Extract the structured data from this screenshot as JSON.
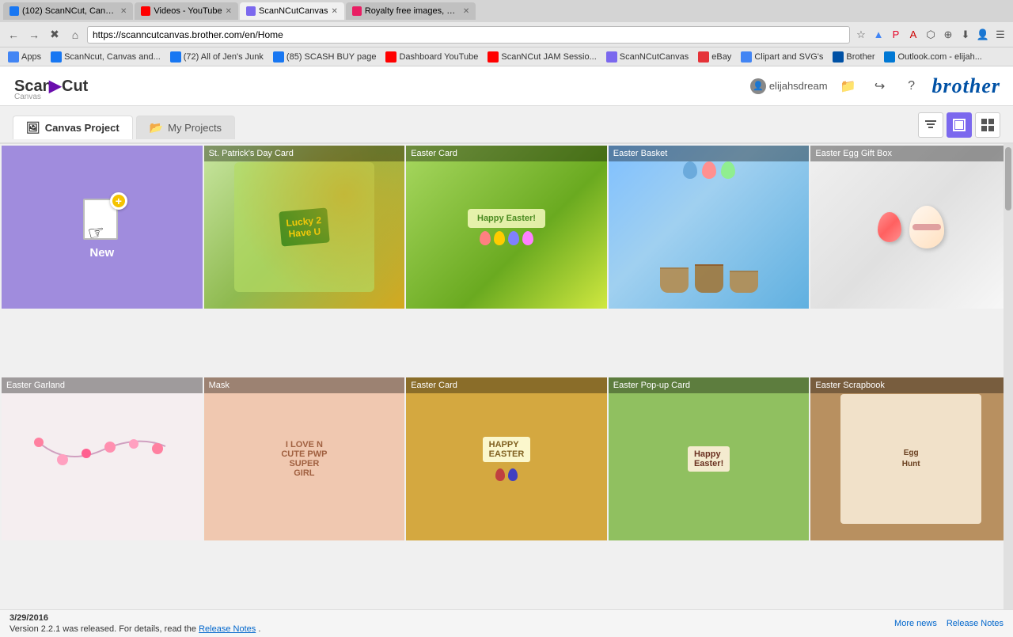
{
  "browser": {
    "tabs": [
      {
        "id": "tab1",
        "label": "(102) ScanNCut, Canvas...",
        "favicon_color": "#1877f2",
        "active": false
      },
      {
        "id": "tab2",
        "label": "Videos - YouTube",
        "favicon_color": "#ff0000",
        "active": false
      },
      {
        "id": "tab3",
        "label": "ScanNCutCanvas",
        "favicon_color": "#7b68ee",
        "active": true
      },
      {
        "id": "tab4",
        "label": "Royalty free images, pho...",
        "favicon_color": "#e91e63",
        "active": false
      }
    ],
    "address": "https://scanncutcanvas.brother.com/en/Home",
    "bookmarks": [
      {
        "label": "Apps",
        "favicon_color": "#4285f4"
      },
      {
        "label": "ScanNcut, Canvas and...",
        "favicon_color": "#1877f2"
      },
      {
        "label": "(72) All of Jen's Junk",
        "favicon_color": "#1877f2"
      },
      {
        "label": "(85) SCASH BUY page",
        "favicon_color": "#1877f2"
      },
      {
        "label": "Dashboard YouTube",
        "favicon_color": "#ff0000"
      },
      {
        "label": "ScanNCut JAM Sessio...",
        "favicon_color": "#ff0000"
      },
      {
        "label": "ScanNCutCanvas",
        "favicon_color": "#7b68ee"
      },
      {
        "label": "eBay",
        "favicon_color": "#e53238"
      },
      {
        "label": "Clipart and SVG's",
        "favicon_color": "#4285f4"
      },
      {
        "label": "Brother",
        "favicon_color": "#0051a5"
      },
      {
        "label": "Outlook.com - elijah...",
        "favicon_color": "#0078d4"
      }
    ]
  },
  "app": {
    "logo_scan": "Scan",
    "logo_ncut": "NCut",
    "logo_canvas": "Canvas",
    "username": "elijahsdream",
    "brother_label": "brother"
  },
  "tabs": {
    "canvas_project_label": "Canvas Project",
    "my_projects_label": "My Projects"
  },
  "view_buttons": {
    "filter_icon": "⊟",
    "single_icon": "▣",
    "grid_icon": "⊞"
  },
  "projects": {
    "new_label": "New",
    "items": [
      {
        "id": "stpatrick",
        "title": "St. Patrick's Day Card",
        "style": "card-stpatrick"
      },
      {
        "id": "easter-card-1",
        "title": "Easter Card",
        "style": "card-easter1"
      },
      {
        "id": "basket",
        "title": "Easter Basket",
        "style": "card-basket"
      },
      {
        "id": "egg-box",
        "title": "Easter Egg Gift Box",
        "style": "card-egg"
      },
      {
        "id": "garland",
        "title": "Easter Garland",
        "style": "card-garland"
      },
      {
        "id": "mask",
        "title": "Mask",
        "style": "card-mask"
      },
      {
        "id": "easter-card-2",
        "title": "Easter Card",
        "style": "card-easter2"
      },
      {
        "id": "popup",
        "title": "Easter Pop-up Card",
        "style": "card-popup"
      },
      {
        "id": "scrapbook",
        "title": "Easter Scrapbook",
        "style": "card-scrapbook"
      }
    ]
  },
  "footer": {
    "date": "3/29/2016",
    "message": "Version 2.2.1 was released. For details, read the",
    "release_link": "Release Notes",
    "period": ".",
    "more_news": "More news",
    "release_notes": "Release Notes"
  }
}
